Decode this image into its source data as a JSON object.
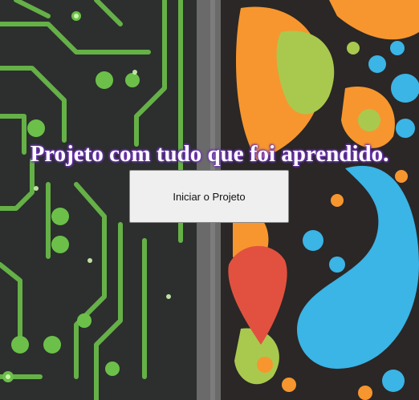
{
  "page": {
    "title": "Projeto com tudo que foi aprendido.",
    "start_button_label": "Iniciar o Projeto"
  },
  "background": {
    "left_panel": "circuit-board-art",
    "right_panel": "colorful-abstract-shapes-art",
    "colors": {
      "circuit_dark": "#2c2f2e",
      "circuit_green": "#6cc04a",
      "divider_gray": "#6a6a6a",
      "orange": "#f7962e",
      "lime": "#a9c94e",
      "sky_blue": "#3bb4e6",
      "red": "#e2513f"
    }
  }
}
